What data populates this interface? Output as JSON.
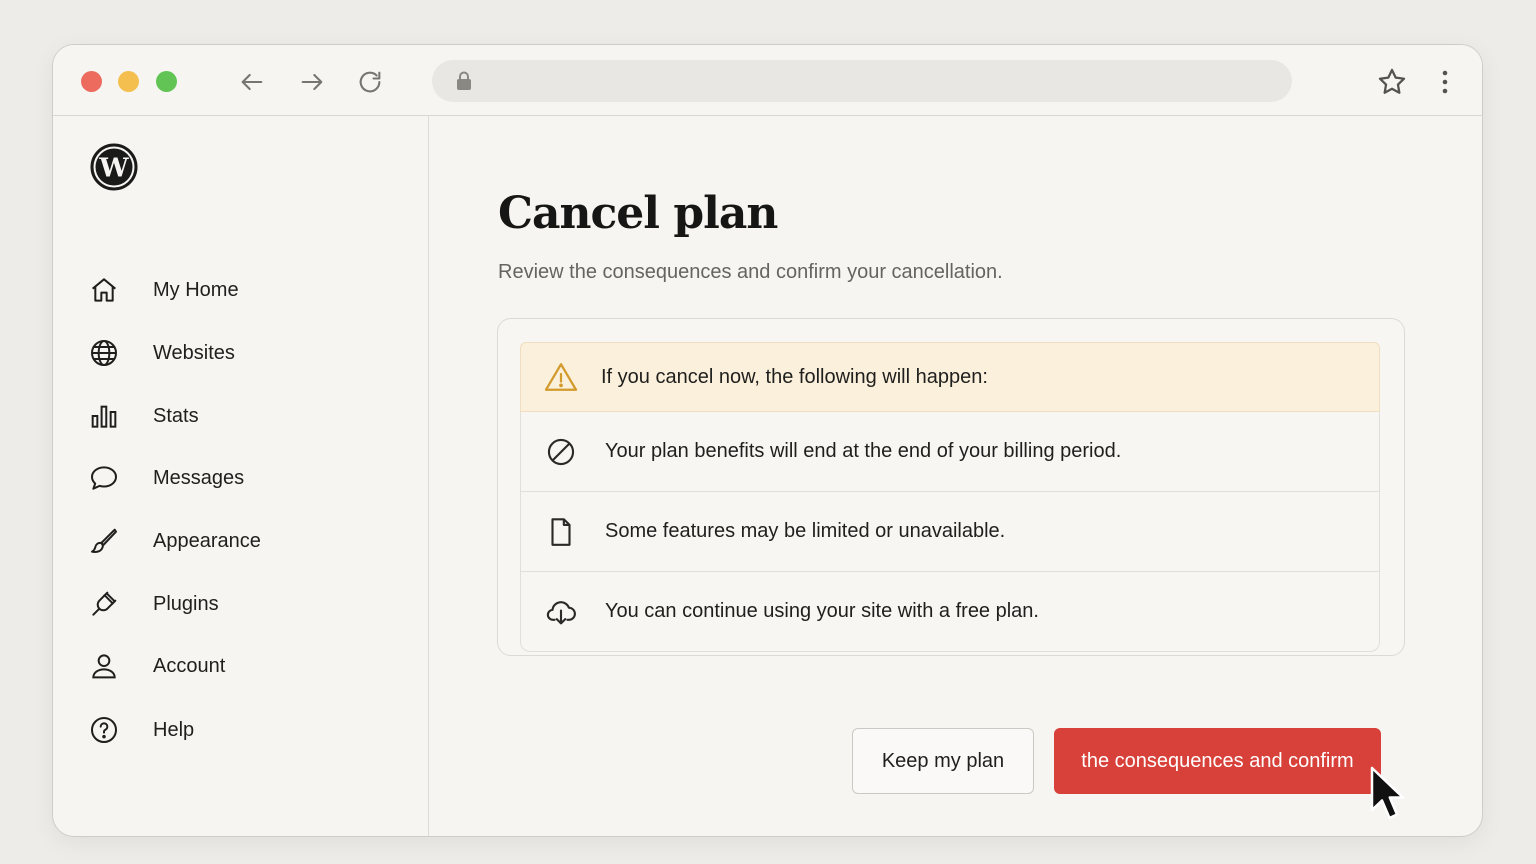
{
  "browser": {
    "url": "",
    "colors": {
      "close": "#ec6a5e",
      "minimize": "#f4bf4f",
      "maximize": "#61c454"
    }
  },
  "sidebar": {
    "items": [
      {
        "label": "My Home",
        "icon": "home-icon"
      },
      {
        "label": "Websites",
        "icon": "globe-icon"
      },
      {
        "label": "Stats",
        "icon": "bar-chart-icon"
      },
      {
        "label": "Messages",
        "icon": "speech-bubble-icon"
      },
      {
        "label": "Appearance",
        "icon": "paintbrush-icon"
      },
      {
        "label": "Plugins",
        "icon": "plug-icon"
      },
      {
        "label": "Account",
        "icon": "person-icon"
      },
      {
        "label": "Help",
        "icon": "help-circle-icon"
      }
    ]
  },
  "main": {
    "title": "Cancel plan",
    "subtitle": "Review the consequences and confirm your cancellation.",
    "warning": "If you cancel now, the following will happen:",
    "consequences": [
      {
        "text": "Your plan benefits will end at the end of your billing period.",
        "icon": "prohibited-icon"
      },
      {
        "text": "Some features may be limited or unavailable.",
        "icon": "document-icon"
      },
      {
        "text": "You can continue using your site with a free plan.",
        "icon": "cloud-download-icon"
      }
    ],
    "keep_label": "Keep my plan",
    "confirm_label": "the consequences and confirm",
    "accent_color": "#d8413a",
    "warning_color": "#fbf0dc"
  }
}
